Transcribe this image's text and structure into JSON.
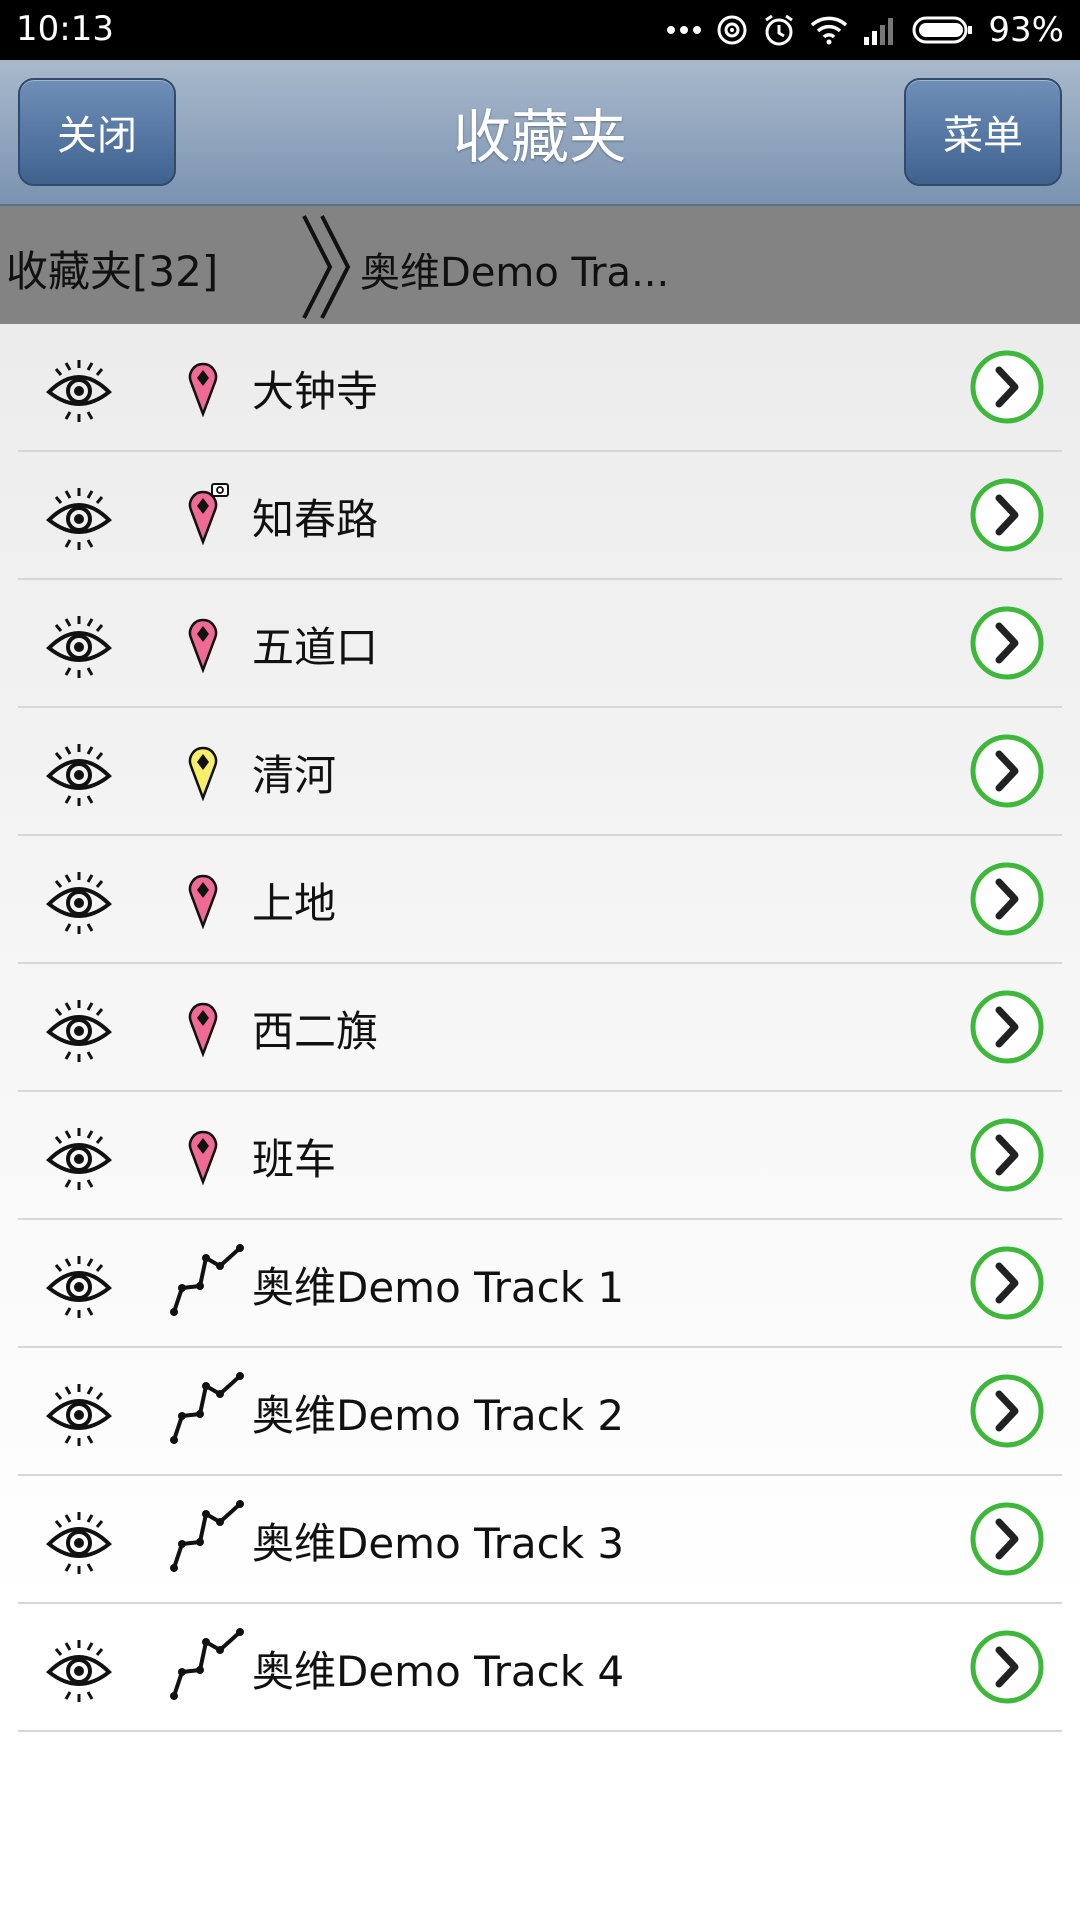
{
  "status_bar": {
    "time": "10:13",
    "battery": "93%"
  },
  "header": {
    "close_label": "关闭",
    "title": "收藏夹",
    "menu_label": "菜单"
  },
  "breadcrumb": {
    "root": "收藏夹[32]",
    "current": "奥维Demo Tra..."
  },
  "items": [
    {
      "label": "大钟寺",
      "icon": "pin-icon",
      "pin_color": "#f06a93"
    },
    {
      "label": "知春路",
      "icon": "pin-photo-icon",
      "pin_color": "#f06a93"
    },
    {
      "label": "五道口",
      "icon": "pin-icon",
      "pin_color": "#f06a93"
    },
    {
      "label": "清河",
      "icon": "pin-icon",
      "pin_color": "#f6ee6a"
    },
    {
      "label": "上地",
      "icon": "pin-icon",
      "pin_color": "#f06a93"
    },
    {
      "label": "西二旗",
      "icon": "pin-icon",
      "pin_color": "#f06a93"
    },
    {
      "label": "班车",
      "icon": "pin-icon",
      "pin_color": "#f06a93"
    },
    {
      "label": "奥维Demo Track 1",
      "icon": "track-icon"
    },
    {
      "label": "奥维Demo Track 2",
      "icon": "track-icon"
    },
    {
      "label": "奥维Demo Track 3",
      "icon": "track-icon"
    },
    {
      "label": "奥维Demo Track 4",
      "icon": "track-icon"
    }
  ],
  "colors": {
    "accent_green": "#3db83a"
  }
}
